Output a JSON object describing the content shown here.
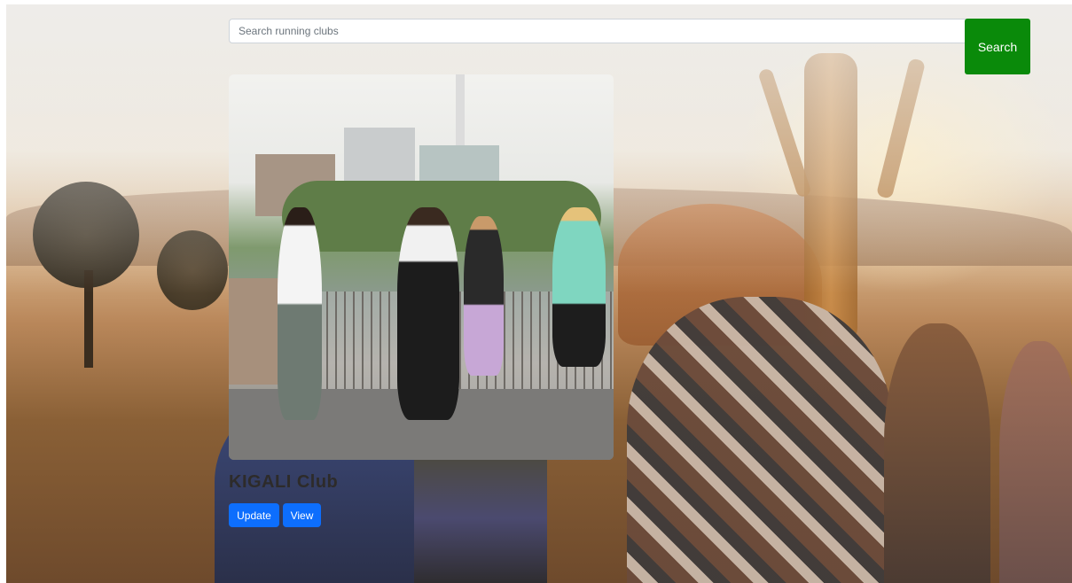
{
  "search": {
    "placeholder": "Search running clubs",
    "value": "",
    "button_label": "Search",
    "button_color": "#0a8a0a"
  },
  "clubs": [
    {
      "name": "KIGALI Club",
      "actions": {
        "update_label": "Update",
        "view_label": "View"
      },
      "button_color": "#0d6efd"
    }
  ]
}
